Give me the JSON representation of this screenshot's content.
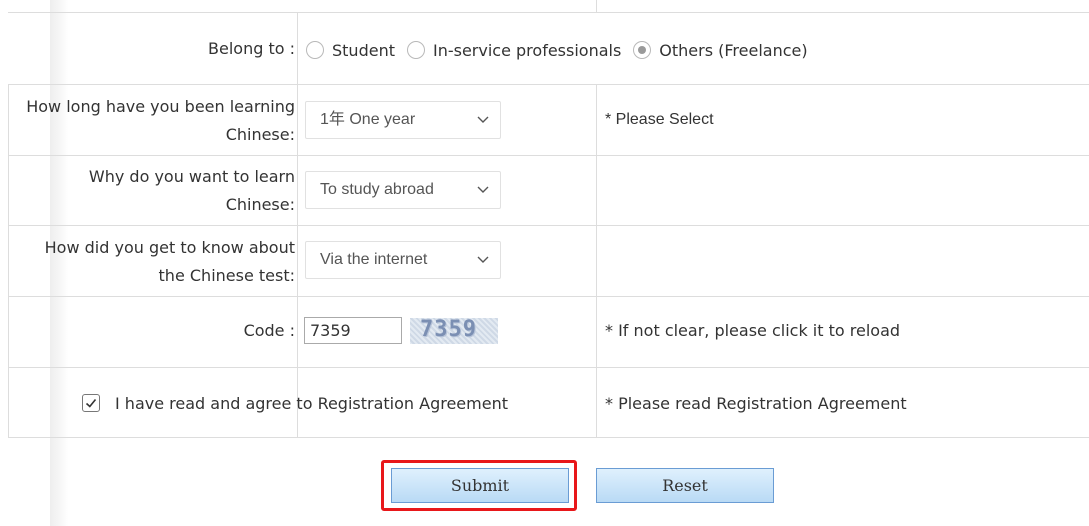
{
  "form": {
    "belong_to": {
      "label": "Belong to :",
      "options": [
        {
          "label": "Student",
          "checked": false
        },
        {
          "label": "In-service professionals",
          "checked": false
        },
        {
          "label": "Others (Freelance)",
          "checked": true
        }
      ]
    },
    "learning_duration": {
      "label_line1": "How long have you been learning",
      "label_line2": "Chinese:",
      "selected": "1年 One year",
      "note": "* Please Select"
    },
    "learning_reason": {
      "label_line1": "Why do you want to learn",
      "label_line2": "Chinese:",
      "selected": "To study abroad"
    },
    "how_known": {
      "label_line1": "How did you get to know about",
      "label_line2": "the Chinese test:",
      "selected": "Via the internet"
    },
    "code": {
      "label": "Code :",
      "value": "7359",
      "captcha_text": "7359",
      "note": "*  If not clear, please click it to reload"
    },
    "agreement": {
      "checked": true,
      "label": "I have read and agree to Registration Agreement",
      "note": "*  Please read Registration Agreement"
    }
  },
  "buttons": {
    "submit": "Submit",
    "reset": "Reset"
  },
  "colors": {
    "highlight": "#e8171a",
    "button_border": "#6a9cd4",
    "grid_line": "#dddddd"
  }
}
